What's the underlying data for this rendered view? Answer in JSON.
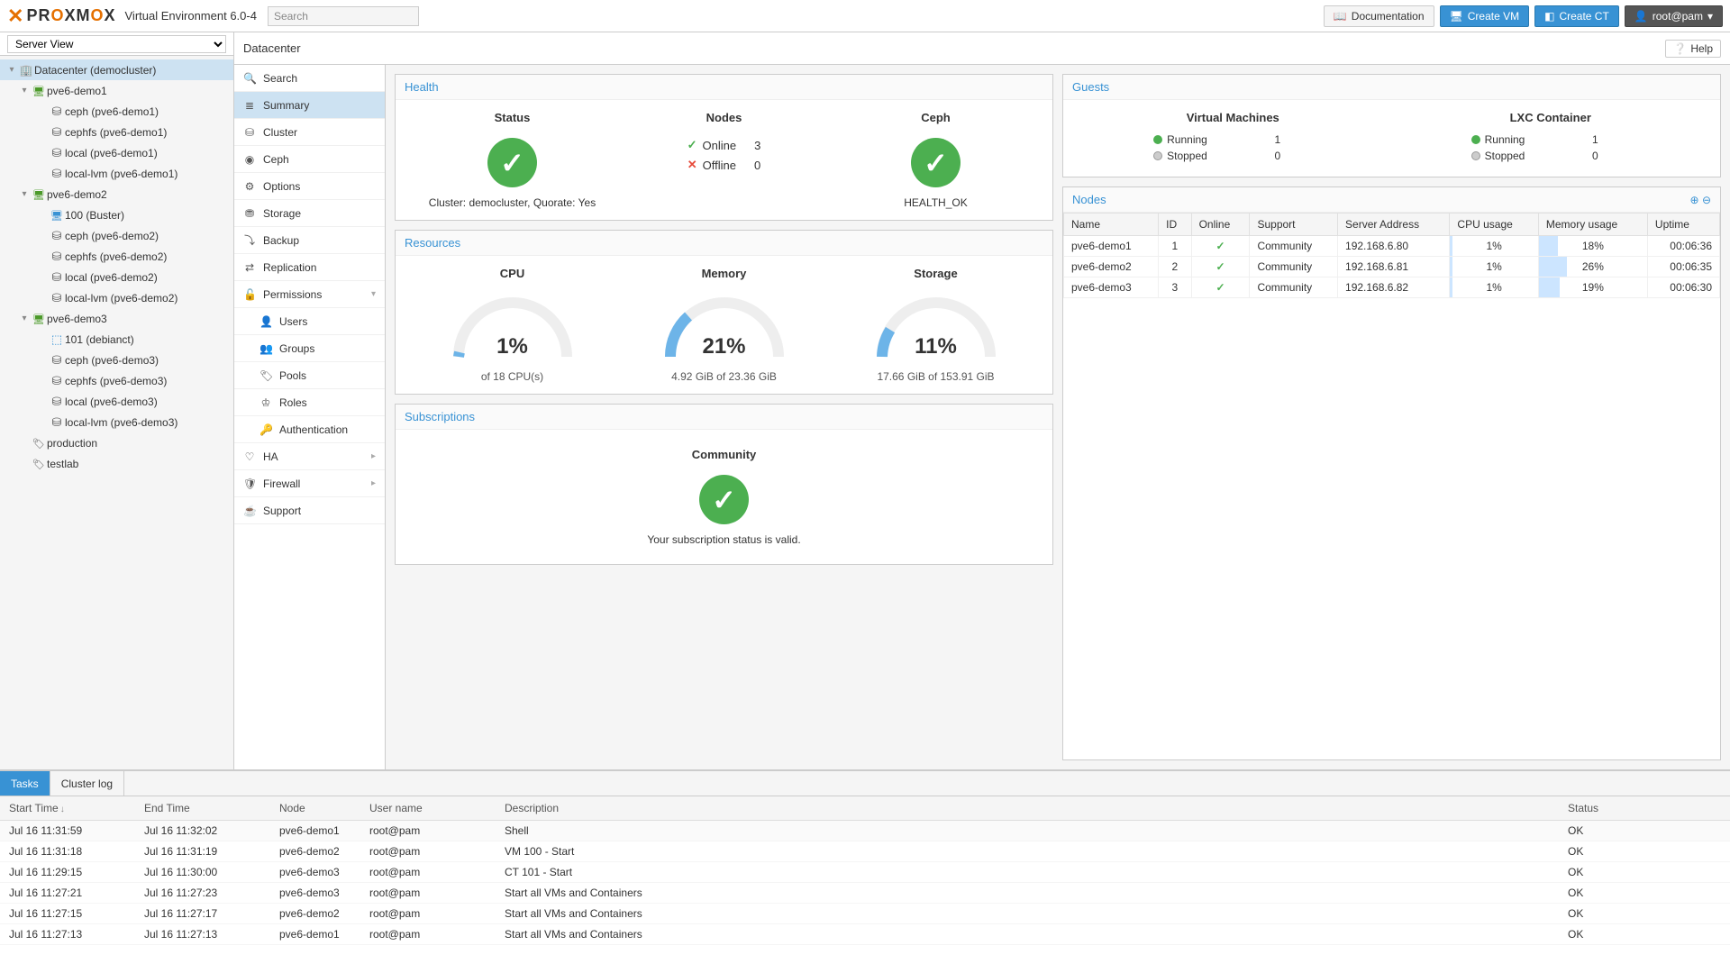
{
  "header": {
    "product": "PROXMOX",
    "subtitle": "Virtual Environment 6.0-4",
    "search_placeholder": "Search",
    "buttons": {
      "documentation": "Documentation",
      "create_vm": "Create VM",
      "create_ct": "Create CT",
      "user": "root@pam"
    }
  },
  "left": {
    "view_label": "Server View",
    "tree": [
      {
        "level": 0,
        "exp": "▾",
        "ico": "building",
        "label": "Datacenter (democluster)",
        "sel": true
      },
      {
        "level": 1,
        "exp": "▾",
        "ico": "server",
        "label": "pve6-demo1"
      },
      {
        "level": 2,
        "exp": "",
        "ico": "disk",
        "label": "ceph (pve6-demo1)"
      },
      {
        "level": 2,
        "exp": "",
        "ico": "disk",
        "label": "cephfs (pve6-demo1)"
      },
      {
        "level": 2,
        "exp": "",
        "ico": "disk",
        "label": "local (pve6-demo1)"
      },
      {
        "level": 2,
        "exp": "",
        "ico": "disk",
        "label": "local-lvm (pve6-demo1)"
      },
      {
        "level": 1,
        "exp": "▾",
        "ico": "server",
        "label": "pve6-demo2"
      },
      {
        "level": 2,
        "exp": "",
        "ico": "vm",
        "label": "100 (Buster)"
      },
      {
        "level": 2,
        "exp": "",
        "ico": "disk",
        "label": "ceph (pve6-demo2)"
      },
      {
        "level": 2,
        "exp": "",
        "ico": "disk",
        "label": "cephfs (pve6-demo2)"
      },
      {
        "level": 2,
        "exp": "",
        "ico": "disk",
        "label": "local (pve6-demo2)"
      },
      {
        "level": 2,
        "exp": "",
        "ico": "disk",
        "label": "local-lvm (pve6-demo2)"
      },
      {
        "level": 1,
        "exp": "▾",
        "ico": "server",
        "label": "pve6-demo3"
      },
      {
        "level": 2,
        "exp": "",
        "ico": "ct",
        "label": "101 (debianct)"
      },
      {
        "level": 2,
        "exp": "",
        "ico": "disk",
        "label": "ceph (pve6-demo3)"
      },
      {
        "level": 2,
        "exp": "",
        "ico": "disk",
        "label": "cephfs (pve6-demo3)"
      },
      {
        "level": 2,
        "exp": "",
        "ico": "disk",
        "label": "local (pve6-demo3)"
      },
      {
        "level": 2,
        "exp": "",
        "ico": "disk",
        "label": "local-lvm (pve6-demo3)"
      },
      {
        "level": 1,
        "exp": "",
        "ico": "tag",
        "label": "production"
      },
      {
        "level": 1,
        "exp": "",
        "ico": "tag",
        "label": "testlab"
      }
    ]
  },
  "content": {
    "title": "Datacenter",
    "help": "Help",
    "menu": [
      {
        "label": "Search",
        "ico": "🔍"
      },
      {
        "label": "Summary",
        "ico": "≣",
        "sel": true
      },
      {
        "label": "Cluster",
        "ico": "⛁"
      },
      {
        "label": "Ceph",
        "ico": "◉"
      },
      {
        "label": "Options",
        "ico": "⚙"
      },
      {
        "label": "Storage",
        "ico": "⛃"
      },
      {
        "label": "Backup",
        "ico": "⤵"
      },
      {
        "label": "Replication",
        "ico": "⇄"
      },
      {
        "label": "Permissions",
        "ico": "🔓",
        "chev": "▾"
      },
      {
        "label": "Users",
        "ico": "👤",
        "sub": true
      },
      {
        "label": "Groups",
        "ico": "👥",
        "sub": true
      },
      {
        "label": "Pools",
        "ico": "🏷",
        "sub": true
      },
      {
        "label": "Roles",
        "ico": "♔",
        "sub": true
      },
      {
        "label": "Authentication",
        "ico": "🔑",
        "sub": true
      },
      {
        "label": "HA",
        "ico": "♡",
        "chev": "▸"
      },
      {
        "label": "Firewall",
        "ico": "🛡",
        "chev": "▸"
      },
      {
        "label": "Support",
        "ico": "☕"
      }
    ]
  },
  "health": {
    "title": "Health",
    "status_label": "Status",
    "cluster_line": "Cluster: democluster, Quorate: Yes",
    "nodes_label": "Nodes",
    "online_label": "Online",
    "online_count": "3",
    "offline_label": "Offline",
    "offline_count": "0",
    "ceph_label": "Ceph",
    "ceph_status": "HEALTH_OK"
  },
  "guests": {
    "title": "Guests",
    "vm_label": "Virtual Machines",
    "ct_label": "LXC Container",
    "running": "Running",
    "stopped": "Stopped",
    "vm_running": "1",
    "vm_stopped": "0",
    "ct_running": "1",
    "ct_stopped": "0"
  },
  "resources": {
    "title": "Resources",
    "cpu_label": "CPU",
    "cpu_pct": "1%",
    "cpu_sub": "of 18 CPU(s)",
    "mem_label": "Memory",
    "mem_pct": "21%",
    "mem_sub": "4.92 GiB of 23.36 GiB",
    "sto_label": "Storage",
    "sto_pct": "11%",
    "sto_sub": "17.66 GiB of 153.91 GiB"
  },
  "nodes_panel": {
    "title": "Nodes",
    "cols": [
      "Name",
      "ID",
      "Online",
      "Support",
      "Server Address",
      "CPU usage",
      "Memory usage",
      "Uptime"
    ],
    "rows": [
      {
        "name": "pve6-demo1",
        "id": "1",
        "support": "Community",
        "addr": "192.168.6.80",
        "cpu": "1%",
        "cpu_w": 3,
        "mem": "18%",
        "mem_w": 18,
        "uptime": "00:06:36"
      },
      {
        "name": "pve6-demo2",
        "id": "2",
        "support": "Community",
        "addr": "192.168.6.81",
        "cpu": "1%",
        "cpu_w": 3,
        "mem": "26%",
        "mem_w": 26,
        "uptime": "00:06:35"
      },
      {
        "name": "pve6-demo3",
        "id": "3",
        "support": "Community",
        "addr": "192.168.6.82",
        "cpu": "1%",
        "cpu_w": 3,
        "mem": "19%",
        "mem_w": 19,
        "uptime": "00:06:30"
      }
    ]
  },
  "subs": {
    "title": "Subscriptions",
    "heading": "Community",
    "text": "Your subscription status is valid."
  },
  "tasks": {
    "tab_tasks": "Tasks",
    "tab_log": "Cluster log",
    "cols": [
      "Start Time",
      "End Time",
      "Node",
      "User name",
      "Description",
      "Status"
    ],
    "rows": [
      {
        "start": "Jul 16 11:31:59",
        "end": "Jul 16 11:32:02",
        "node": "pve6-demo1",
        "user": "root@pam",
        "desc": "Shell",
        "status": "OK"
      },
      {
        "start": "Jul 16 11:31:18",
        "end": "Jul 16 11:31:19",
        "node": "pve6-demo2",
        "user": "root@pam",
        "desc": "VM 100 - Start",
        "status": "OK"
      },
      {
        "start": "Jul 16 11:29:15",
        "end": "Jul 16 11:30:00",
        "node": "pve6-demo3",
        "user": "root@pam",
        "desc": "CT 101 - Start",
        "status": "OK"
      },
      {
        "start": "Jul 16 11:27:21",
        "end": "Jul 16 11:27:23",
        "node": "pve6-demo3",
        "user": "root@pam",
        "desc": "Start all VMs and Containers",
        "status": "OK"
      },
      {
        "start": "Jul 16 11:27:15",
        "end": "Jul 16 11:27:17",
        "node": "pve6-demo2",
        "user": "root@pam",
        "desc": "Start all VMs and Containers",
        "status": "OK"
      },
      {
        "start": "Jul 16 11:27:13",
        "end": "Jul 16 11:27:13",
        "node": "pve6-demo1",
        "user": "root@pam",
        "desc": "Start all VMs and Containers",
        "status": "OK"
      }
    ]
  }
}
